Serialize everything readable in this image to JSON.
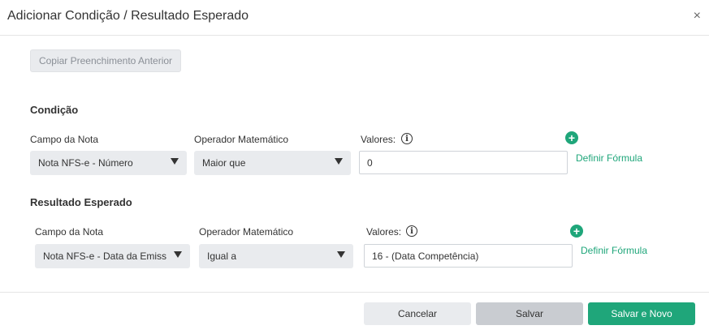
{
  "dialog": {
    "title": "Adicionar Condição / Resultado Esperado",
    "close_icon": "×"
  },
  "copy_button": {
    "label": "Copiar Preenchimento Anterior"
  },
  "condition": {
    "section_title": "Condição",
    "field_label": "Campo da Nota",
    "field_value": "Nota NFS-e - Número",
    "operator_label": "Operador Matemático",
    "operator_value": "Maior que",
    "values_label": "Valores:",
    "values_value": "0",
    "formula_link": "Definir Fórmula",
    "plus_icon": "+",
    "info_icon": "i"
  },
  "result": {
    "section_title": "Resultado Esperado",
    "field_label": "Campo da Nota",
    "field_value": "Nota NFS-e - Data da Emissã",
    "operator_label": "Operador Matemático",
    "operator_value": "Igual a",
    "values_label": "Valores:",
    "values_value": "16 - (Data Competência)",
    "formula_link": "Definir Fórmula",
    "plus_icon": "+",
    "info_icon": "i"
  },
  "footer": {
    "cancel_label": "Cancelar",
    "save_label": "Salvar",
    "save_new_label": "Salvar e Novo"
  },
  "colors": {
    "accent": "#1fa67a",
    "select_bg": "#e9ebee"
  }
}
